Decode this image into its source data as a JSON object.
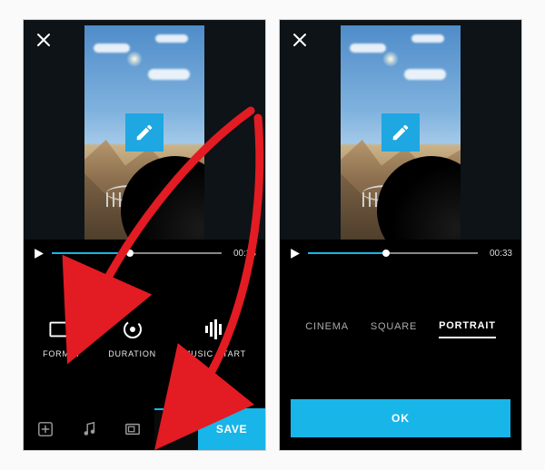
{
  "colors": {
    "accent": "#18b5e9",
    "edit_badge": "#1ea7e1",
    "arrow": "#e31b23"
  },
  "left": {
    "close": "×",
    "playback": {
      "time": "00:33",
      "progress_pct": 46
    },
    "tools": {
      "format": {
        "label": "FORMAT"
      },
      "duration": {
        "label": "DURATION"
      },
      "musicstart": {
        "label": "MUSIC START"
      }
    },
    "save": "SAVE"
  },
  "right": {
    "close": "×",
    "playback": {
      "time": "00:33",
      "progress_pct": 46
    },
    "aspect": {
      "cinema": "CINEMA",
      "square": "SQUARE",
      "portrait": "PORTRAIT",
      "selected": "portrait"
    },
    "ok": "OK"
  }
}
